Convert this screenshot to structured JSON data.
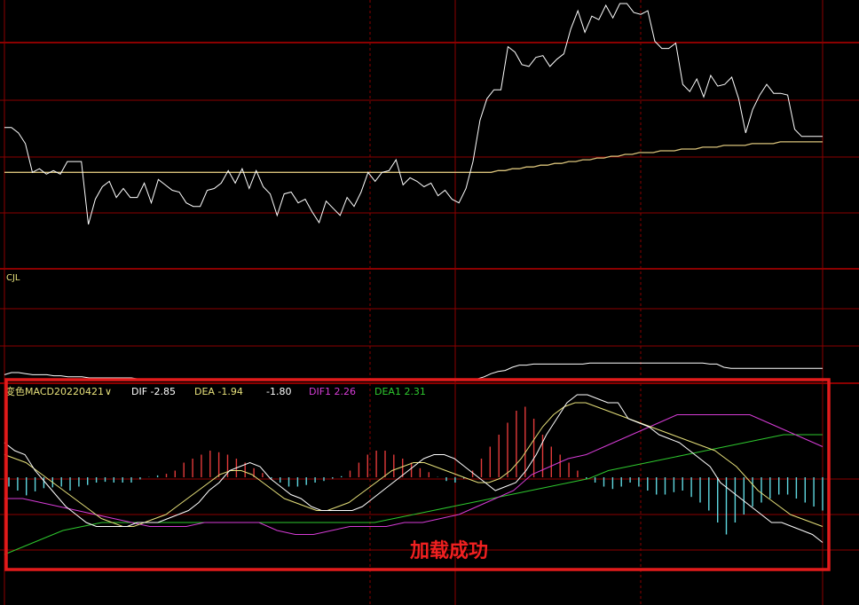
{
  "volume_panel": {
    "label": "CJL"
  },
  "macd_panel": {
    "indicator_name": "变色MACD20220421",
    "dropdown_glyph": "∨",
    "readouts": [
      {
        "text": "DIF -2.85",
        "color": "#ffffff"
      },
      {
        "text": "DEA -1.94",
        "color": "#e6e07a"
      },
      {
        "text": "-1.80",
        "color": "#ffffff"
      },
      {
        "text": "DIF1 2.26",
        "color": "#d63cd6"
      },
      {
        "text": "DEA1 2.31",
        "color": "#2ec82e"
      }
    ]
  },
  "overlay": {
    "message": "加载成功",
    "border_color": "#e21b1b",
    "text_color": "#f02020"
  },
  "colors": {
    "grid": "#8b0000",
    "price": "#ffffff",
    "ma": "#d9c27a",
    "volume_line": "#ffffff",
    "histogram_positive": "#e23a3a",
    "histogram_negative": "#5ed8e0",
    "dif": "#ffffff",
    "dea": "#e6e07a",
    "dif1": "#d63cd6",
    "dea1": "#2ec82e"
  },
  "chart_data": [
    {
      "type": "line",
      "panel": "price",
      "y_range": [
        0,
        100
      ],
      "series": [
        {
          "key": "price",
          "values": [
            55,
            55,
            52,
            46,
            30,
            32,
            29,
            31,
            29,
            36,
            36,
            36,
            1,
            15,
            22,
            25,
            16,
            21,
            16,
            16,
            24,
            13,
            26,
            23,
            20,
            19,
            13,
            11,
            11,
            20,
            21,
            24,
            31,
            24,
            32,
            21,
            31,
            22,
            18,
            6,
            18,
            19,
            13,
            15,
            8,
            2,
            14,
            10,
            6,
            16,
            11,
            19,
            30,
            25,
            30,
            31,
            37,
            23,
            27,
            25,
            22,
            24,
            17,
            20,
            15,
            13,
            21,
            36,
            59,
            71,
            76,
            76,
            100,
            97,
            90,
            89,
            94,
            95,
            89,
            93,
            96,
            110,
            120,
            108,
            117,
            115,
            123,
            116,
            124,
            124,
            119,
            118,
            120,
            103,
            99,
            99,
            102,
            79,
            75,
            82,
            72,
            84,
            78,
            79,
            83,
            71,
            52,
            65,
            73,
            79,
            74,
            74,
            73,
            54,
            50,
            50,
            50,
            50
          ]
        },
        {
          "key": "ma",
          "values": [
            30,
            30,
            30,
            30,
            30,
            30,
            30,
            30,
            30,
            30,
            30,
            30,
            30,
            30,
            30,
            30,
            30,
            30,
            30,
            30,
            30,
            30,
            30,
            30,
            30,
            30,
            30,
            30,
            30,
            30,
            30,
            30,
            30,
            30,
            30,
            30,
            30,
            30,
            30,
            30,
            30,
            30,
            30,
            30,
            30,
            30,
            30,
            30,
            30,
            30,
            30,
            30,
            30,
            30,
            30,
            30,
            30,
            30,
            30,
            30,
            30,
            30,
            30,
            30,
            30,
            30,
            30,
            30,
            30,
            30,
            31,
            31,
            32,
            32,
            33,
            33,
            34,
            34,
            35,
            35,
            36,
            36,
            37,
            37,
            38,
            38,
            39,
            39,
            40,
            40,
            41,
            41,
            41,
            42,
            42,
            42,
            43,
            43,
            43,
            44,
            44,
            44,
            45,
            45,
            45,
            45,
            46,
            46,
            46,
            46,
            47,
            47,
            47,
            47,
            47,
            47,
            47
          ]
        }
      ]
    },
    {
      "type": "line",
      "panel": "volume",
      "series": [
        {
          "key": "volume",
          "values": [
            8,
            10,
            10,
            9,
            8,
            8,
            8,
            7,
            7,
            6,
            6,
            6,
            5,
            5,
            5,
            5,
            5,
            5,
            5,
            4,
            4,
            4,
            4,
            4,
            4,
            4,
            4,
            4,
            4,
            4,
            4,
            4,
            4,
            4,
            4,
            4,
            4,
            4,
            4,
            4,
            4,
            4,
            4,
            4,
            4,
            4,
            4,
            4,
            4,
            4,
            4,
            4,
            4,
            4,
            4,
            4,
            4,
            4,
            4,
            4,
            4,
            4,
            4,
            4,
            4,
            4,
            4,
            4,
            6,
            9,
            11,
            12,
            15,
            17,
            17,
            18,
            18,
            18,
            18,
            18,
            18,
            18,
            18,
            19,
            19,
            19,
            19,
            19,
            19,
            19,
            19,
            19,
            19,
            19,
            19,
            19,
            19,
            19,
            19,
            19,
            18,
            18,
            15,
            14,
            14,
            14,
            14,
            14,
            14,
            14,
            14,
            14,
            14,
            14,
            14,
            14,
            14
          ]
        }
      ]
    },
    {
      "type": "line",
      "panel": "macd",
      "y_range": [
        -10,
        10
      ],
      "series": [
        {
          "key": "hist",
          "values": [
            -1.5,
            -2.0,
            -2.6,
            -2.1,
            -1.7,
            -1.6,
            -1.5,
            -2.0,
            -1.5,
            -1.3,
            -1.0,
            -0.9,
            -1.0,
            -1.0,
            -1.0,
            -0.6,
            -0.3,
            -0.1,
            0.1,
            0.5,
            1.5,
            2.0,
            2.5,
            3.0,
            2.8,
            2.5,
            2.0,
            1.5,
            0.8,
            0.2,
            -0.5,
            -1.0,
            -1.5,
            -1.5,
            -1.3,
            -1.0,
            -0.8,
            -0.5,
            -0.2,
            0.5,
            1.5,
            2.5,
            3.0,
            3.0,
            2.5,
            2.0,
            1.5,
            0.8,
            0.3,
            -0.3,
            -0.8,
            -1.0,
            -0.5,
            0.5,
            2.0,
            3.5,
            5.0,
            6.5,
            8.0,
            8.5,
            7.0,
            5.0,
            3.5,
            2.5,
            1.5,
            0.5,
            -0.5,
            -1.0,
            -1.5,
            -1.8,
            -1.5,
            -1.0,
            -1.5,
            -2.0,
            -2.5,
            -2.5,
            -2.2,
            -2.0,
            -2.8,
            -3.5,
            -4.5,
            -6.0,
            -7.5,
            -6.0,
            -5.0,
            -4.0,
            -3.5,
            -3.0,
            -2.5,
            -2.5,
            -3.0,
            -3.5,
            -4.0,
            -4.5
          ]
        },
        {
          "key": "dif",
          "values": [
            4.0,
            3.0,
            2.5,
            0.5,
            -1.0,
            -2.5,
            -4.0,
            -5.0,
            -6.0,
            -6.5,
            -6.5,
            -6.5,
            -6.5,
            -6.0,
            -6.0,
            -6.0,
            -5.5,
            -5.0,
            -4.5,
            -3.5,
            -2.0,
            -1.0,
            0.5,
            1.0,
            1.5,
            1.0,
            -0.5,
            -1.5,
            -2.5,
            -3.0,
            -4.0,
            -4.5,
            -4.5,
            -4.5,
            -4.5,
            -4.0,
            -3.0,
            -2.0,
            -1.0,
            0.0,
            1.0,
            2.0,
            2.5,
            2.5,
            2.0,
            1.0,
            0.0,
            -1.0,
            -2.0,
            -1.5,
            -1.0,
            0.5,
            2.5,
            5.0,
            7.0,
            9.0,
            10.0,
            10.0,
            9.5,
            9.0,
            9.0,
            7.0,
            6.5,
            6.0,
            5.0,
            4.5,
            4.0,
            3.0,
            2.0,
            1.0,
            -1.0,
            -2.0,
            -3.0,
            -4.0,
            -5.0,
            -6.0,
            -6.0,
            -6.5,
            -7.0,
            -7.5,
            -8.5
          ]
        },
        {
          "key": "dea",
          "values": [
            2.5,
            2.0,
            1.5,
            0.5,
            -0.5,
            -1.5,
            -2.5,
            -3.5,
            -4.5,
            -5.5,
            -6.0,
            -6.5,
            -6.5,
            -6.0,
            -5.5,
            -5.0,
            -4.0,
            -3.0,
            -2.0,
            -1.0,
            0.0,
            0.5,
            0.5,
            0.0,
            -1.0,
            -2.0,
            -3.0,
            -3.5,
            -4.0,
            -4.5,
            -4.5,
            -4.0,
            -3.5,
            -2.5,
            -1.5,
            -0.5,
            0.5,
            1.0,
            1.5,
            1.5,
            1.0,
            0.5,
            0.0,
            -0.5,
            -1.0,
            -1.0,
            -0.5,
            0.5,
            2.0,
            4.0,
            6.0,
            7.5,
            8.5,
            9.0,
            9.0,
            8.5,
            8.0,
            7.5,
            7.0,
            6.5,
            6.0,
            5.5,
            5.0,
            4.5,
            4.0,
            3.5,
            3.0,
            2.0,
            1.0,
            -0.5,
            -2.0,
            -3.0,
            -4.0,
            -5.0,
            -5.5,
            -6.0,
            -6.5
          ]
        },
        {
          "key": "dif1",
          "values": [
            -3.0,
            -3.0,
            -3.5,
            -4.0,
            -4.5,
            -5.0,
            -5.5,
            -6.0,
            -6.5,
            -6.5,
            -6.5,
            -6.0,
            -6.0,
            -6.0,
            -6.0,
            -7.0,
            -7.5,
            -7.5,
            -7.0,
            -6.5,
            -6.5,
            -6.5,
            -6.0,
            -6.0,
            -5.5,
            -5.0,
            -4.0,
            -3.0,
            -2.0,
            0.0,
            1.0,
            2.0,
            2.5,
            3.5,
            4.5,
            5.5,
            6.5,
            7.5,
            7.5,
            7.5,
            7.5,
            7.5,
            6.5,
            5.5,
            4.5,
            3.5
          ]
        },
        {
          "key": "dea1",
          "values": [
            -10.0,
            -9.0,
            -8.0,
            -7.0,
            -6.5,
            -6.0,
            -6.0,
            -6.0,
            -6.0,
            -6.0,
            -6.0,
            -6.0,
            -6.0,
            -6.0,
            -6.0,
            -6.0,
            -6.0,
            -6.0,
            -6.0,
            -6.0,
            -5.5,
            -5.0,
            -4.5,
            -4.0,
            -3.5,
            -3.0,
            -2.5,
            -2.0,
            -1.5,
            -1.0,
            -0.5,
            0.5,
            1.0,
            1.5,
            2.0,
            2.5,
            3.0,
            3.5,
            4.0,
            4.5,
            5.0,
            5.0,
            5.0
          ]
        }
      ]
    }
  ]
}
